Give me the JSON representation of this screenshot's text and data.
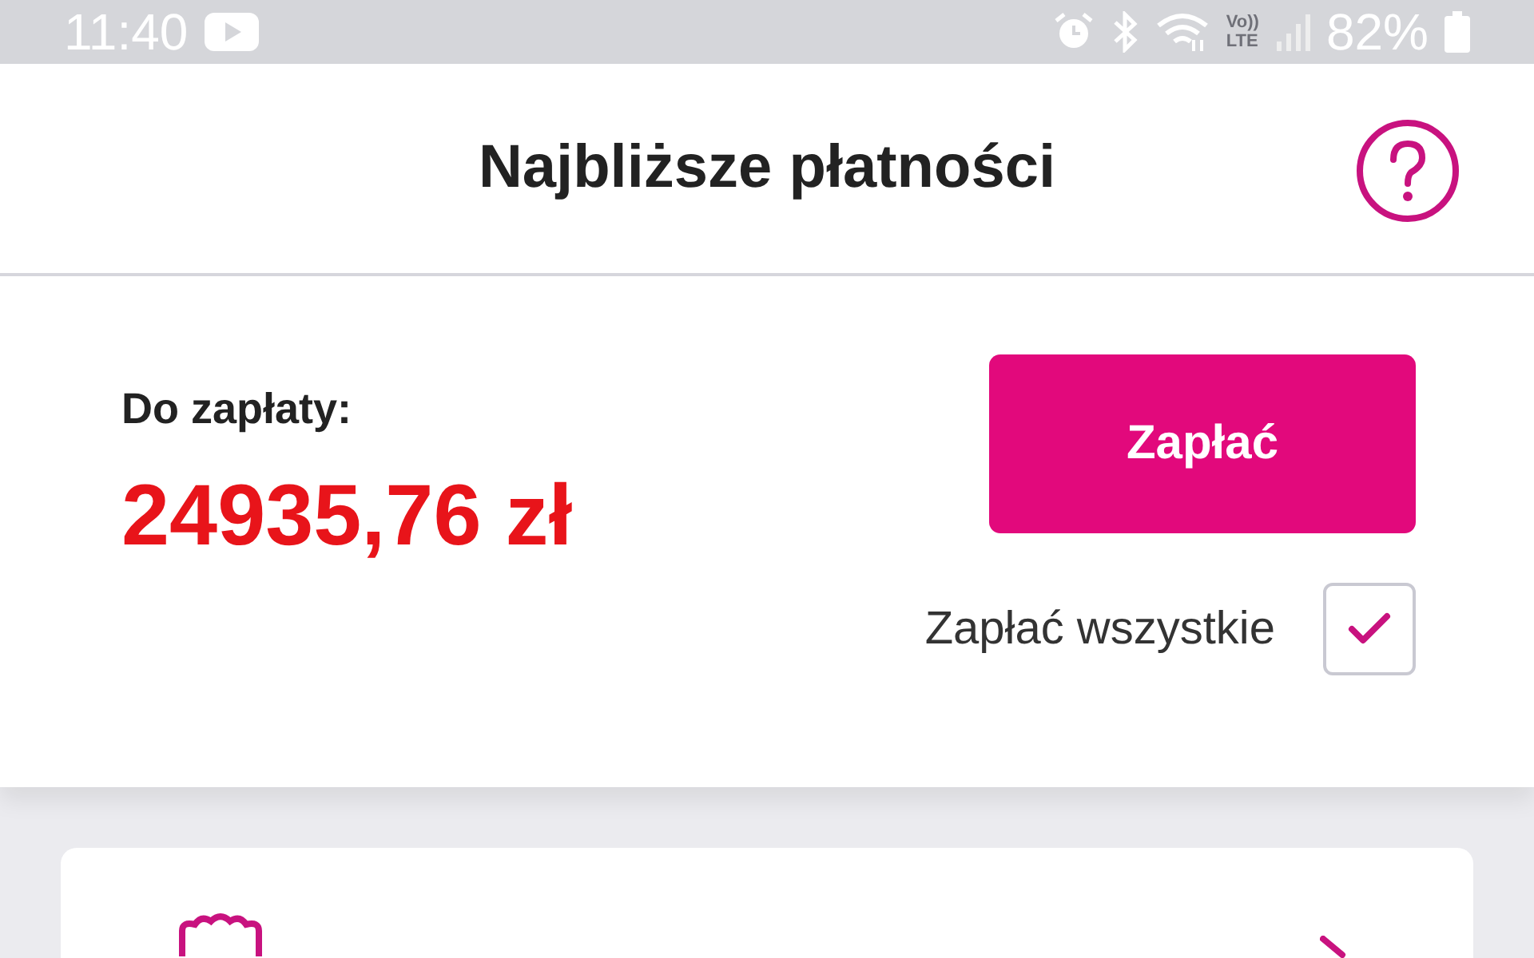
{
  "status_bar": {
    "time": "11:40",
    "volte": [
      "Vo))",
      "LTE"
    ],
    "battery": "82%"
  },
  "header": {
    "title": "Najbliższe płatności"
  },
  "summary": {
    "label": "Do zapłaty:",
    "amount": "24935,76 zł",
    "pay_button": "Zapłać",
    "pay_all": {
      "label": "Zapłać wszystkie",
      "checked": true
    }
  }
}
